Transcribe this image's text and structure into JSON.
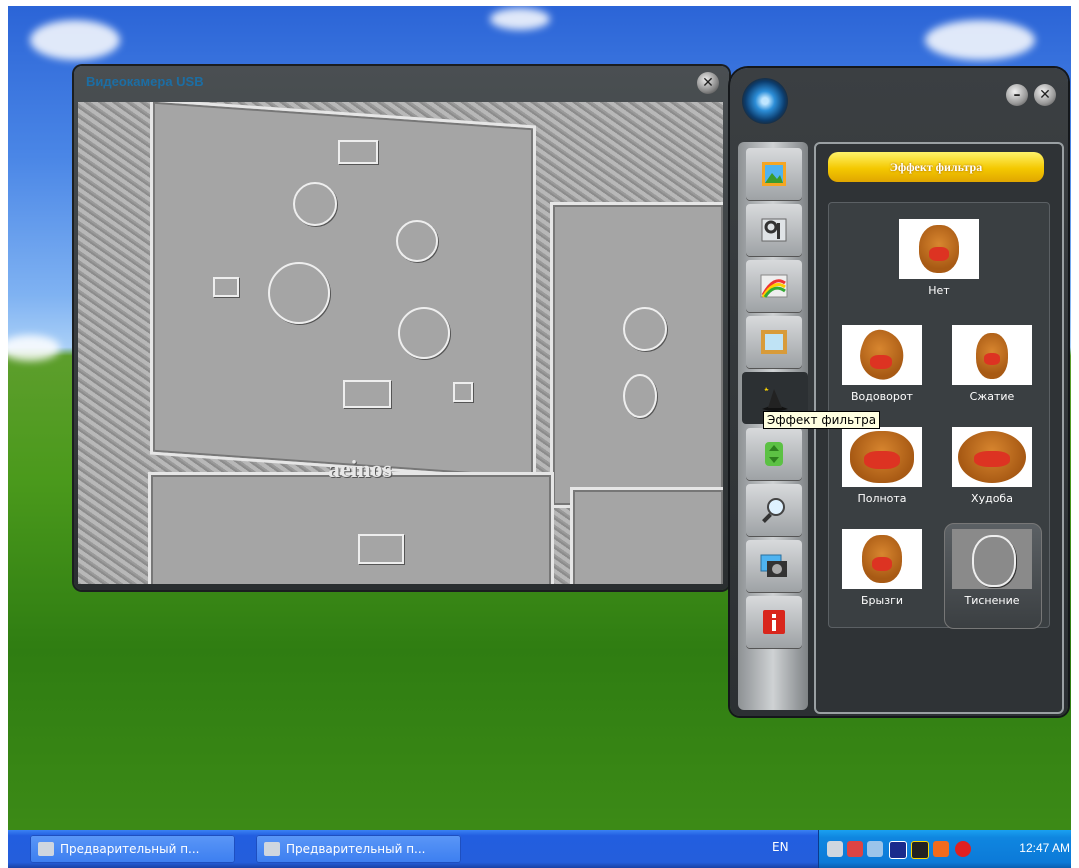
{
  "video_window": {
    "title": "Видеокамера USB",
    "close_glyph": "✕",
    "plate_text": "aeinos"
  },
  "panel": {
    "header": "Эффект фильтра",
    "minimize_glyph": "–",
    "close_glyph": "✕",
    "tabs": [
      {
        "name": "photo-tab",
        "icon": "picture-icon"
      },
      {
        "name": "settings-tab",
        "icon": "tools-icon"
      },
      {
        "name": "rainbow-tab",
        "icon": "rainbow-icon"
      },
      {
        "name": "frame-tab",
        "icon": "frame-icon"
      },
      {
        "name": "filter-effect-tab",
        "icon": "magic-hat-icon"
      },
      {
        "name": "export-tab",
        "icon": "green-arrows-icon"
      },
      {
        "name": "zoom-tab",
        "icon": "magnifier-icon"
      },
      {
        "name": "capture-tab",
        "icon": "camera-icon"
      },
      {
        "name": "info-tab",
        "icon": "info-icon"
      }
    ],
    "effects": [
      {
        "label": "Нет"
      },
      {
        "label": "Водоворот"
      },
      {
        "label": "Сжатие"
      },
      {
        "label": "Полнота"
      },
      {
        "label": "Худоба"
      },
      {
        "label": "Брызги"
      },
      {
        "label": "Тиснение",
        "selected": true
      }
    ],
    "tooltip": "Эффект фильтра"
  },
  "taskbar": {
    "buttons": [
      {
        "label": "Предварительный п..."
      },
      {
        "label": "Предварительный п..."
      }
    ],
    "language": "EN",
    "clock": "12:47 AM"
  }
}
